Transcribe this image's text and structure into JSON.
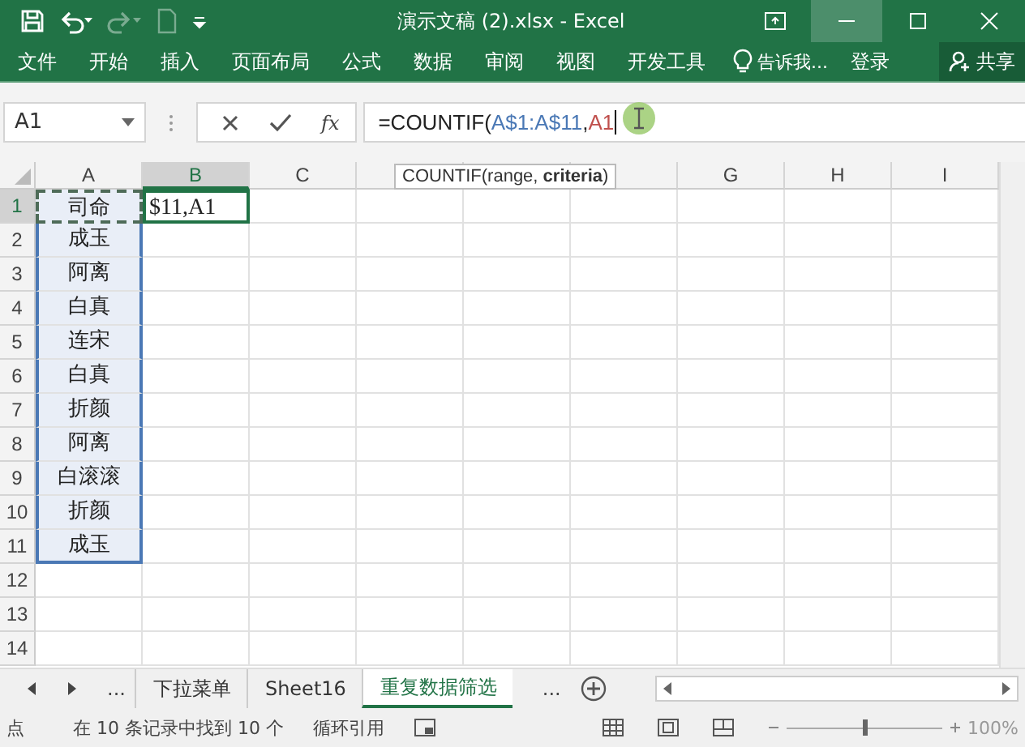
{
  "window": {
    "title": "演示文稿 (2).xlsx - Excel"
  },
  "ribbon": {
    "tabs": [
      {
        "label": "文件",
        "selected": false
      },
      {
        "label": "开始",
        "selected": false
      },
      {
        "label": "插入",
        "selected": false
      },
      {
        "label": "页面布局",
        "selected": false
      },
      {
        "label": "公式",
        "selected": false
      },
      {
        "label": "数据",
        "selected": false
      },
      {
        "label": "审阅",
        "selected": false
      },
      {
        "label": "视图",
        "selected": false
      },
      {
        "label": "开发工具",
        "selected": false
      }
    ],
    "tell_me": "告诉我...",
    "sign_in": "登录",
    "share": "共享"
  },
  "formula_bar": {
    "name_box": "A1",
    "fx": "fx",
    "segments": [
      {
        "text": "=COUNTIF(",
        "color": "#222222"
      },
      {
        "text": "A$1:A$11",
        "color": "#4a78b5"
      },
      {
        "text": ",",
        "color": "#222222"
      },
      {
        "text": "A1",
        "color": "#c0504d"
      }
    ]
  },
  "tooltip": "COUNTIF(range, **criteria**)",
  "columns": [
    {
      "label": "A",
      "selected": false
    },
    {
      "label": "B",
      "selected": true
    },
    {
      "label": "C",
      "selected": false
    },
    {
      "selected": false
    },
    {
      "selected": false
    },
    {
      "selected": false
    },
    {
      "label": "G",
      "selected": false
    },
    {
      "label": "H",
      "selected": false
    },
    {
      "label": "I",
      "selected": false
    }
  ],
  "rows": [
    {
      "header": "1",
      "selected": true,
      "cells": [
        {
          "text": "司命",
          "in_range": true,
          "referenced": true
        },
        {
          "text": "$11,A1",
          "editing": true
        }
      ]
    },
    {
      "header": "2",
      "selected": false,
      "cells": [
        {
          "text": "成玉",
          "in_range": true
        }
      ]
    },
    {
      "header": "3",
      "selected": false,
      "cells": [
        {
          "text": "阿离",
          "in_range": true
        }
      ]
    },
    {
      "header": "4",
      "selected": false,
      "cells": [
        {
          "text": "白真",
          "in_range": true
        }
      ]
    },
    {
      "header": "5",
      "selected": false,
      "cells": [
        {
          "text": "连宋",
          "in_range": true
        }
      ]
    },
    {
      "header": "6",
      "selected": false,
      "cells": [
        {
          "text": "白真",
          "in_range": true
        }
      ]
    },
    {
      "header": "7",
      "selected": false,
      "cells": [
        {
          "text": "折颜",
          "in_range": true
        }
      ]
    },
    {
      "header": "8",
      "selected": false,
      "cells": [
        {
          "text": "阿离",
          "in_range": true
        }
      ]
    },
    {
      "header": "9",
      "selected": false,
      "cells": [
        {
          "text": "白滚滚",
          "in_range": true
        }
      ]
    },
    {
      "header": "10",
      "selected": false,
      "cells": [
        {
          "text": "折颜",
          "in_range": true
        }
      ]
    },
    {
      "header": "11",
      "selected": false,
      "cells": [
        {
          "text": "成玉",
          "in_range": true
        }
      ]
    },
    {
      "header": "12",
      "selected": false,
      "cells": []
    },
    {
      "header": "13",
      "selected": false,
      "cells": []
    },
    {
      "header": "14",
      "selected": false,
      "cells": []
    }
  ],
  "sheet_tabs": {
    "more_left": "...",
    "tabs": [
      {
        "label": "下拉菜单",
        "selected": false
      },
      {
        "label": "Sheet16",
        "selected": false
      },
      {
        "label": "重复数据筛选",
        "selected": true
      }
    ],
    "more_right": "..."
  },
  "status_bar": {
    "mode": "点",
    "message": "在 10 条记录中找到 10 个",
    "circular": "循环引用",
    "zoom": {
      "level": 0.5,
      "reading": "100%"
    }
  }
}
